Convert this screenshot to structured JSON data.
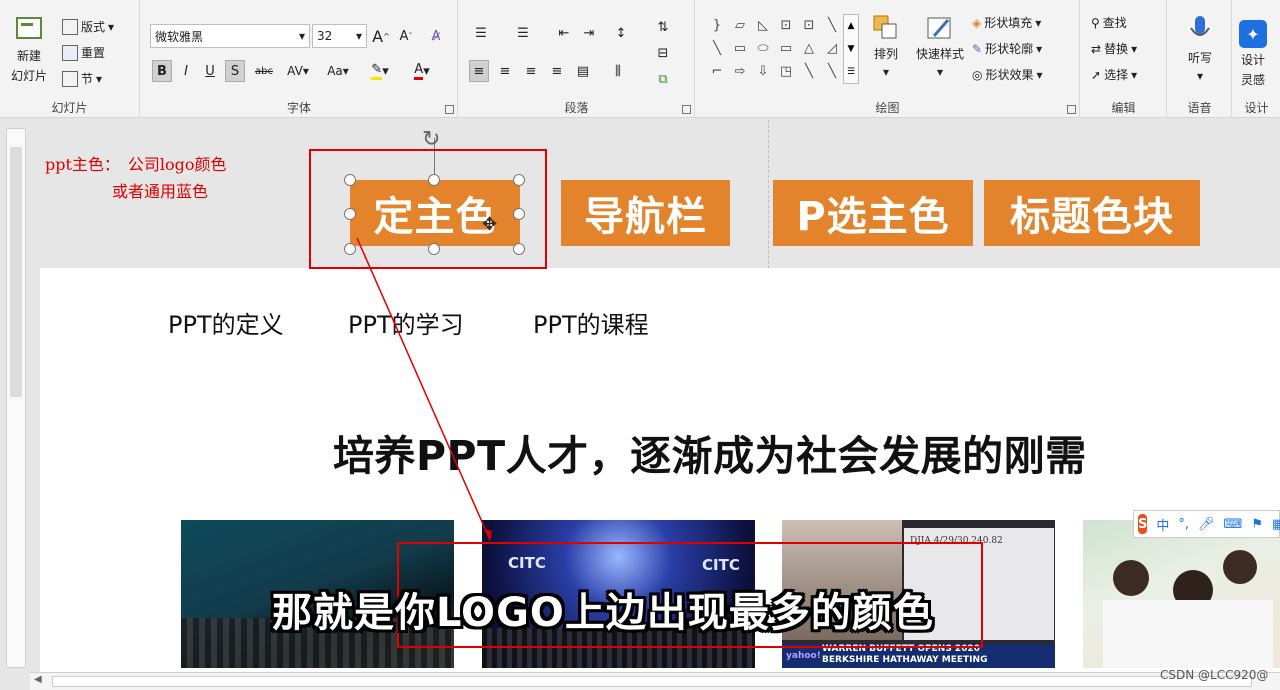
{
  "ribbon": {
    "slides_group": {
      "label": "幻灯片",
      "new_slide": "新建",
      "new_slide_2": "幻灯片",
      "layout": "版式",
      "reset": "重置",
      "section": "节"
    },
    "font_group": {
      "label": "字体",
      "font_name": "微软雅黑",
      "font_size": "32",
      "bold": "B",
      "italic": "I",
      "underline": "U",
      "shadow": "S",
      "strike": "abc",
      "spacing": "AV",
      "case": "Aa",
      "grow": "A",
      "shrink": "A"
    },
    "paragraph_group": {
      "label": "段落"
    },
    "drawing_group": {
      "label": "绘图",
      "arrange": "排列",
      "quick_styles": "快速样式",
      "shape_fill": "形状填充",
      "shape_outline": "形状轮廓",
      "shape_effects": "形状效果"
    },
    "editing_group": {
      "label": "编辑",
      "find": "查找",
      "replace": "替换",
      "select": "选择"
    },
    "voice_group": {
      "label": "语音",
      "dictate": "听写"
    },
    "designer_group": {
      "label": "设计",
      "designer": "设计",
      "designer_2": "灵感"
    }
  },
  "annotations": {
    "line1": "ppt主色：　公司logo颜色",
    "line2": "或者通用蓝色"
  },
  "orange_blocks": [
    "定主色",
    "导航栏",
    "P选主色",
    "标题色块"
  ],
  "slide": {
    "nav_items": [
      "PPT的定义",
      "PPT的学习",
      "PPT的课程"
    ],
    "headline": "培养PPT人才，逐渐成为社会发展的刚需",
    "photo_texts": {
      "p2_logo": "CITC",
      "p3_caption": "WARREN BUFFETT OPENS 2020",
      "p3_caption2": "BERKSHIRE HATHAWAY MEETING",
      "p3_brand": "yahoo!",
      "p3_doc": "DJIA  4/29/30  240.82"
    }
  },
  "subtitle": "那就是你LOGO上边出现最多的颜色",
  "ime": {
    "logo": "S",
    "mode": "中"
  },
  "watermark": "CSDN @LCC920@",
  "colors": {
    "accent": "#e3832b",
    "annotation_red": "#e00000"
  }
}
